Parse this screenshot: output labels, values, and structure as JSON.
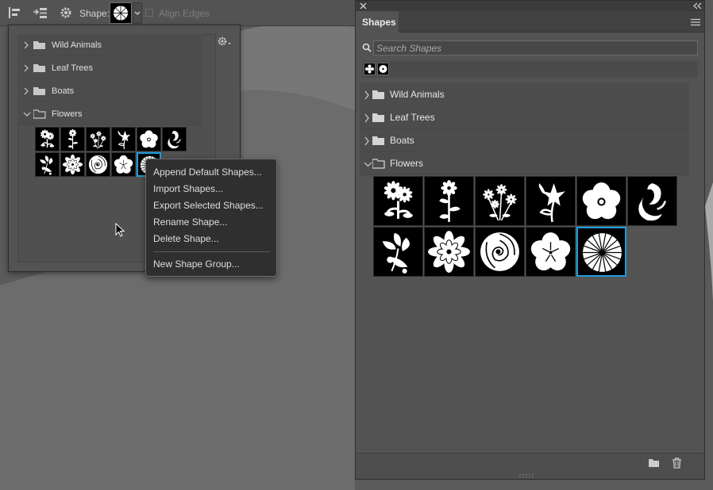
{
  "toolbar": {
    "shape_label": "Shape:",
    "align_edges_label": "Align Edges",
    "icons": [
      "align-icon",
      "arrange-icon",
      "gear-icon",
      "chevron-down-icon"
    ]
  },
  "picker": {
    "groups": [
      {
        "label": "Wild Animals",
        "expanded": false
      },
      {
        "label": "Leaf Trees",
        "expanded": false
      },
      {
        "label": "Boats",
        "expanded": false
      },
      {
        "label": "Flowers",
        "expanded": true
      }
    ]
  },
  "context_menu": {
    "items": [
      "Append Default Shapes...",
      "Import Shapes...",
      "Export Selected Shapes...",
      "Rename Shape...",
      "Delete Shape...",
      "New Shape Group..."
    ]
  },
  "panel": {
    "title": "Shapes",
    "search_placeholder": "Search Shapes",
    "groups": [
      {
        "label": "Wild Animals",
        "expanded": false
      },
      {
        "label": "Leaf Trees",
        "expanded": false
      },
      {
        "label": "Boats",
        "expanded": false
      },
      {
        "label": "Flowers",
        "expanded": true
      }
    ],
    "flower_shapes": [
      "flower-1",
      "flower-2",
      "flower-3",
      "flower-4",
      "flower-5",
      "flower-6",
      "flower-7",
      "flower-8",
      "flower-9",
      "flower-10",
      "flower-11"
    ],
    "selected_shape": "flower-11"
  },
  "colors": {
    "selection": "#1d9bdd",
    "panel": "#535353",
    "menu": "#2f2f2f"
  }
}
